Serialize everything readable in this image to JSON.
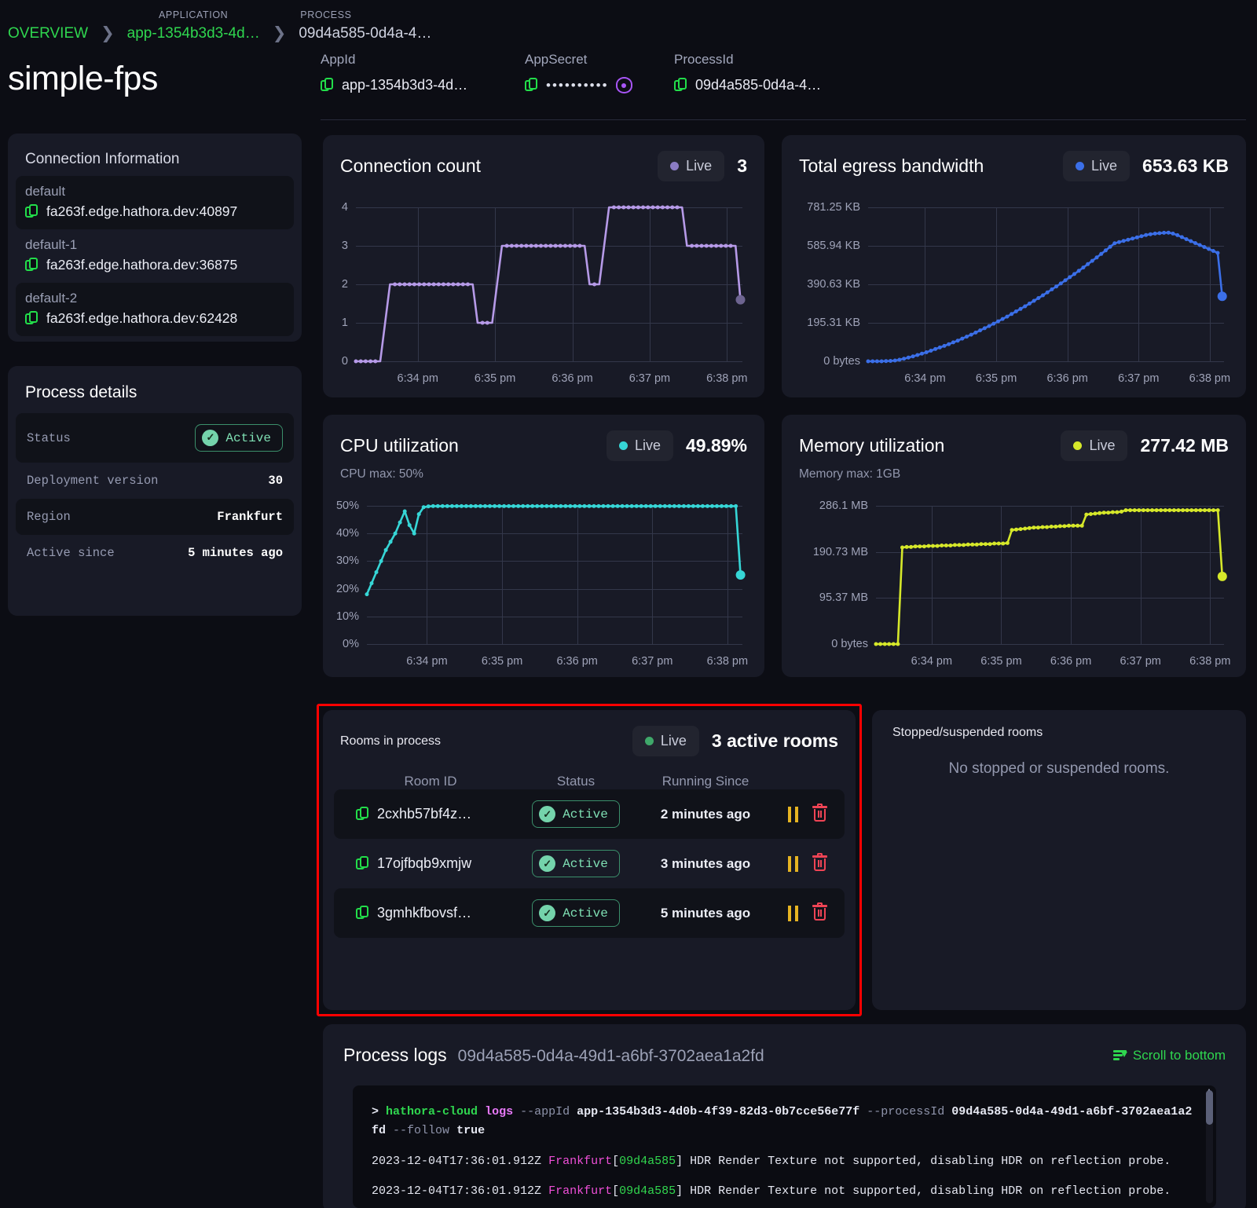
{
  "breadcrumb": {
    "overview": "OVERVIEW",
    "app_caption": "APPLICATION",
    "app_value": "app-1354b3d3-4d…",
    "process_caption": "PROCESS",
    "process_value": "09d4a585-0d4a-4…"
  },
  "page_title": "simple-fps",
  "meta": {
    "appid_label": "AppId",
    "appid_value": "app-1354b3d3-4d…",
    "appsecret_label": "AppSecret",
    "appsecret_value": "••••••••••",
    "processid_label": "ProcessId",
    "processid_value": "09d4a585-0d4a-4…"
  },
  "connection": {
    "title": "Connection Information",
    "rows": [
      {
        "name": "default",
        "value": "fa263f.edge.hathora.dev:40897"
      },
      {
        "name": "default-1",
        "value": "fa263f.edge.hathora.dev:36875"
      },
      {
        "name": "default-2",
        "value": "fa263f.edge.hathora.dev:62428"
      }
    ]
  },
  "process_details": {
    "title": "Process details",
    "status_label": "Status",
    "status_value": "Active",
    "deployment_label": "Deployment version",
    "deployment_value": "30",
    "region_label": "Region",
    "region_value": "Frankfurt",
    "active_since_label": "Active since",
    "active_since_value": "5 minutes ago"
  },
  "live_label": "Live",
  "colors": {
    "connection": "#b69ae8",
    "egress": "#3b6fe8",
    "cpu": "#36d6d6",
    "memory": "#d6e82a",
    "accent_green": "#2fd64f",
    "danger": "#ef4455",
    "warning": "#e6b422",
    "highlight_box": "#ff0000"
  },
  "chart_data": [
    {
      "type": "line",
      "title": "Connection count",
      "badge": "Live",
      "current_value": "3",
      "color": "#b69ae8",
      "xlabel": "",
      "ylabel": "",
      "ylim": [
        0,
        4
      ],
      "yticks": [
        "0",
        "1",
        "2",
        "3",
        "4"
      ],
      "xticks": [
        "6:34 pm",
        "6:35 pm",
        "6:36 pm",
        "6:37 pm",
        "6:38 pm"
      ],
      "grid": true,
      "x": [
        0,
        1,
        2,
        3,
        4,
        5,
        6,
        7,
        8,
        9,
        10,
        11,
        12,
        13,
        14,
        15,
        16,
        17,
        18,
        19,
        20,
        21,
        22,
        23,
        24,
        25,
        26,
        27,
        28,
        29,
        30,
        31,
        32,
        33,
        34,
        35,
        36,
        37,
        38,
        39,
        40,
        41,
        42,
        43,
        44,
        45,
        46,
        47,
        48,
        49,
        50,
        51,
        52,
        53,
        54,
        55,
        56,
        57,
        58,
        59,
        60,
        61,
        62,
        63,
        64,
        65,
        66,
        67,
        68,
        69,
        70,
        71,
        72,
        73,
        74,
        75,
        76,
        77,
        78,
        79
      ],
      "values": [
        0,
        0,
        0,
        0,
        0,
        0,
        1,
        2,
        2,
        2,
        2,
        2,
        2,
        2,
        2,
        2,
        2,
        2,
        2,
        2,
        2,
        2,
        2,
        2,
        2,
        1,
        1,
        1,
        1,
        2,
        3,
        3,
        3,
        3,
        3,
        3,
        3,
        3,
        3,
        3,
        3,
        3,
        3,
        3,
        3,
        3,
        3,
        3,
        2,
        2,
        2,
        3,
        4,
        4,
        4,
        4,
        4,
        4,
        4,
        4,
        4,
        4,
        4,
        4,
        4,
        4,
        4,
        4,
        3,
        3,
        3,
        3,
        3,
        3,
        3,
        3,
        3,
        3,
        3,
        1.6
      ]
    },
    {
      "type": "line",
      "title": "Total egress bandwidth",
      "badge": "Live",
      "current_value": "653.63 KB",
      "color": "#3b6fe8",
      "xlabel": "",
      "ylabel": "",
      "ylim": [
        0,
        781.25
      ],
      "yticks": [
        "781.25 KB",
        "585.94 KB",
        "390.63 KB",
        "195.31 KB",
        "0 bytes"
      ],
      "xticks": [
        "6:34 pm",
        "6:35 pm",
        "6:36 pm",
        "6:37 pm",
        "6:38 pm"
      ],
      "grid": true,
      "x": [
        0,
        1,
        2,
        3,
        4,
        5,
        6,
        7,
        8,
        9,
        10,
        11,
        12,
        13,
        14,
        15,
        16,
        17,
        18,
        19,
        20,
        21,
        22,
        23,
        24,
        25,
        26,
        27,
        28,
        29,
        30,
        31,
        32,
        33,
        34,
        35,
        36,
        37,
        38,
        39,
        40,
        41,
        42,
        43,
        44,
        45,
        46,
        47,
        48,
        49,
        50,
        51,
        52,
        53,
        54,
        55,
        56,
        57,
        58,
        59,
        60,
        61,
        62,
        63,
        64,
        65,
        66,
        67,
        68,
        69,
        70,
        71,
        72,
        73,
        74,
        75,
        76,
        77,
        78,
        79
      ],
      "values": [
        0,
        0,
        0,
        0,
        1,
        2,
        4,
        8,
        13,
        19,
        25,
        32,
        39,
        46,
        54,
        62,
        70,
        78,
        87,
        96,
        105,
        115,
        125,
        135,
        146,
        157,
        168,
        179,
        191,
        203,
        215,
        227,
        240,
        253,
        266,
        279,
        293,
        307,
        321,
        335,
        350,
        365,
        380,
        395,
        411,
        427,
        443,
        459,
        476,
        493,
        510,
        527,
        545,
        563,
        581,
        599,
        605,
        611,
        617,
        623,
        629,
        635,
        641,
        645,
        648,
        650,
        652,
        653,
        648,
        640,
        630,
        620,
        610,
        600,
        590,
        580,
        570,
        560,
        550,
        330
      ]
    },
    {
      "type": "line",
      "title": "CPU utilization",
      "badge": "Live",
      "current_value": "49.89%",
      "subtitle": "CPU max: 50%",
      "color": "#36d6d6",
      "xlabel": "",
      "ylabel": "",
      "ylim": [
        0,
        50
      ],
      "yticks": [
        "50%",
        "40%",
        "30%",
        "20%",
        "10%",
        "0%"
      ],
      "xticks": [
        "6:34 pm",
        "6:35 pm",
        "6:36 pm",
        "6:37 pm",
        "6:38 pm"
      ],
      "grid": true,
      "x": [
        0,
        1,
        2,
        3,
        4,
        5,
        6,
        7,
        8,
        9,
        10,
        11,
        12,
        13,
        14,
        15,
        16,
        17,
        18,
        19,
        20,
        21,
        22,
        23,
        24,
        25,
        26,
        27,
        28,
        29,
        30,
        31,
        32,
        33,
        34,
        35,
        36,
        37,
        38,
        39,
        40,
        41,
        42,
        43,
        44,
        45,
        46,
        47,
        48,
        49,
        50,
        51,
        52,
        53,
        54,
        55,
        56,
        57,
        58,
        59,
        60,
        61,
        62,
        63,
        64,
        65,
        66,
        67,
        68,
        69,
        70,
        71,
        72,
        73,
        74,
        75,
        76,
        77,
        78,
        79
      ],
      "values": [
        18,
        22,
        26,
        30,
        34,
        37,
        40,
        44,
        48,
        43,
        40,
        47,
        49.5,
        49.8,
        49.9,
        49.9,
        49.9,
        49.9,
        49.9,
        49.9,
        49.9,
        49.9,
        49.9,
        49.9,
        49.9,
        49.9,
        49.9,
        49.9,
        49.9,
        49.9,
        49.9,
        49.9,
        49.9,
        49.9,
        49.9,
        49.9,
        49.9,
        49.9,
        49.9,
        49.9,
        49.9,
        49.9,
        49.9,
        49.9,
        49.9,
        49.9,
        49.9,
        49.9,
        49.9,
        49.9,
        49.9,
        49.9,
        49.9,
        49.9,
        49.9,
        49.9,
        49.9,
        49.9,
        49.9,
        49.9,
        49.9,
        49.9,
        49.9,
        49.9,
        49.9,
        49.9,
        49.9,
        49.9,
        49.9,
        49.9,
        49.9,
        49.9,
        49.9,
        49.9,
        49.9,
        49.9,
        49.9,
        49.9,
        49.9,
        25
      ]
    },
    {
      "type": "line",
      "title": "Memory utilization",
      "badge": "Live",
      "current_value": "277.42 MB",
      "subtitle": "Memory max: 1GB",
      "color": "#d6e82a",
      "xlabel": "",
      "ylabel": "",
      "ylim": [
        0,
        286.1
      ],
      "yticks": [
        "286.1 MB",
        "190.73 MB",
        "95.37 MB",
        "0 bytes"
      ],
      "xticks": [
        "6:34 pm",
        "6:35 pm",
        "6:36 pm",
        "6:37 pm",
        "6:38 pm"
      ],
      "grid": true,
      "x": [
        0,
        1,
        2,
        3,
        4,
        5,
        6,
        7,
        8,
        9,
        10,
        11,
        12,
        13,
        14,
        15,
        16,
        17,
        18,
        19,
        20,
        21,
        22,
        23,
        24,
        25,
        26,
        27,
        28,
        29,
        30,
        31,
        32,
        33,
        34,
        35,
        36,
        37,
        38,
        39,
        40,
        41,
        42,
        43,
        44,
        45,
        46,
        47,
        48,
        49,
        50,
        51,
        52,
        53,
        54,
        55,
        56,
        57,
        58,
        59,
        60,
        61,
        62,
        63,
        64,
        65,
        66,
        67,
        68,
        69,
        70,
        71,
        72,
        73,
        74,
        75,
        76,
        77,
        78,
        79
      ],
      "values": [
        0,
        0,
        0,
        0,
        0,
        0,
        200,
        201,
        201,
        202,
        202,
        202,
        203,
        203,
        203,
        204,
        204,
        204,
        205,
        205,
        205,
        206,
        206,
        206,
        207,
        207,
        207,
        208,
        208,
        208,
        209,
        236,
        237,
        238,
        239,
        240,
        241,
        241,
        242,
        242,
        243,
        243,
        244,
        244,
        245,
        245,
        245,
        245,
        268,
        269,
        270,
        271,
        272,
        272,
        273,
        273,
        274,
        277,
        277,
        277,
        277,
        277,
        277,
        277,
        277,
        277,
        277,
        277,
        277,
        277,
        277,
        277,
        277,
        277,
        277,
        277,
        277,
        277,
        277,
        140
      ]
    }
  ],
  "rooms": {
    "title": "Rooms in process",
    "badge": "Live",
    "count_text": "3 active rooms",
    "columns": [
      "Room ID",
      "Status",
      "Running Since"
    ],
    "rows": [
      {
        "room_id": "2cxhb57bf4z…",
        "status": "Active",
        "running_since": "2 minutes ago"
      },
      {
        "room_id": "17ojfbqb9xmjw",
        "status": "Active",
        "running_since": "3 minutes ago"
      },
      {
        "room_id": "3gmhkfbovsf…",
        "status": "Active",
        "running_since": "5 minutes ago"
      }
    ]
  },
  "stopped_rooms": {
    "title": "Stopped/suspended rooms",
    "empty_text": "No stopped or suspended rooms."
  },
  "logs": {
    "title": "Process logs",
    "process_id": "09d4a585-0d4a-49d1-a6bf-3702aea1a2fd",
    "scroll_button": "Scroll to bottom",
    "command": {
      "prompt": ">",
      "cli": "hathora-cloud",
      "sub": "logs",
      "flag1": "--appId",
      "appid": "app-1354b3d3-4d0b-4f39-82d3-0b7cce56e77f",
      "flag2": "--processId",
      "processid": "09d4a585-0d4a-49d1-a6bf-3702aea1a2fd",
      "flag3": "--follow",
      "flagval": "true"
    },
    "lines": [
      {
        "ts": "2023-12-04T17:36:01.912Z",
        "region": "Frankfurt",
        "pid": "09d4a585",
        "msg": "HDR Render Texture not supported, disabling HDR on reflection probe."
      },
      {
        "ts": "2023-12-04T17:36:01.912Z",
        "region": "Frankfurt",
        "pid": "09d4a585",
        "msg": "HDR Render Texture not supported, disabling HDR on reflection probe."
      }
    ]
  }
}
